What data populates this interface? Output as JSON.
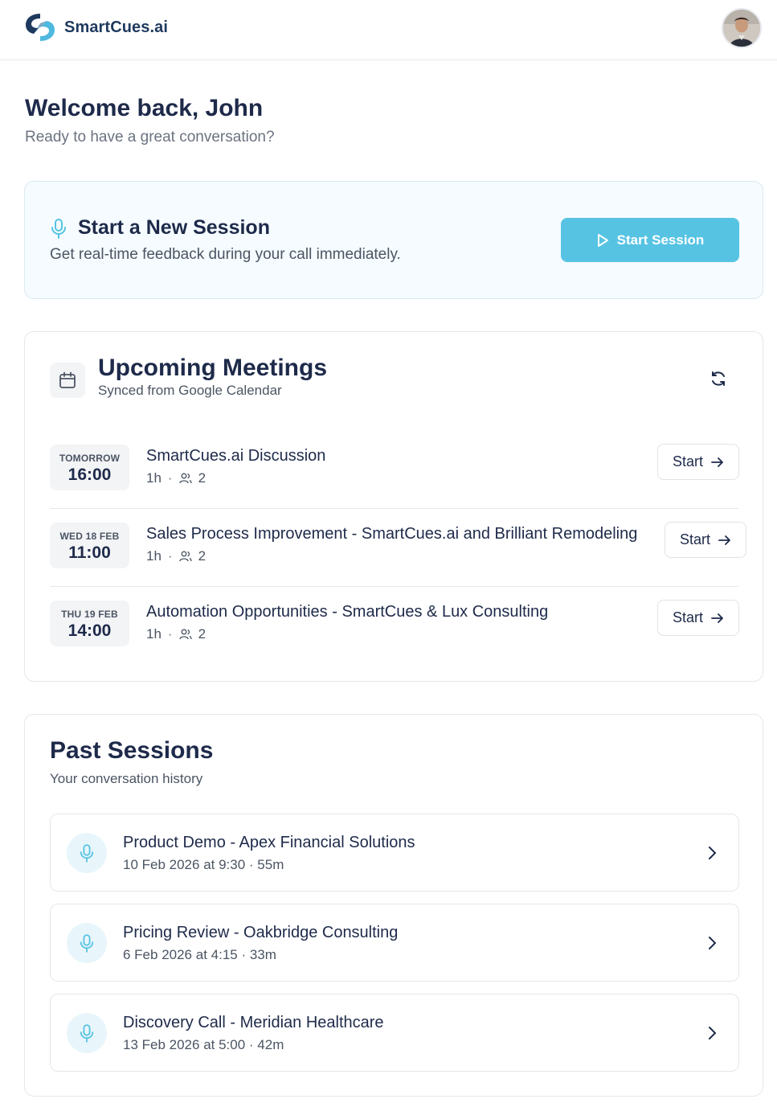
{
  "app": {
    "brand": "SmartCues.ai"
  },
  "user": {
    "avatar": "user-avatar"
  },
  "welcome": {
    "title": "Welcome back, John",
    "subtitle": "Ready to have a great conversation?"
  },
  "new_session": {
    "title": "Start a New Session",
    "subtitle": "Get real-time feedback during your call immediately.",
    "button_label": "Start Session",
    "accent_color": "#56c3e3"
  },
  "upcoming": {
    "title": "Upcoming Meetings",
    "subtitle": "Synced from Google Calendar",
    "meetings": [
      {
        "day": "TOMORROW",
        "time": "16:00",
        "title": "SmartCues.ai Discussion",
        "duration": "1h",
        "attendees": "2",
        "button": "Start"
      },
      {
        "day": "WED 18 FEB",
        "time": "11:00",
        "title": "Sales Process Improvement - SmartCues.ai and Brilliant Remodeling",
        "duration": "1h",
        "attendees": "2",
        "button": "Start"
      },
      {
        "day": "THU 19 FEB",
        "time": "14:00",
        "title": "Automation Opportunities - SmartCues & Lux Consulting",
        "duration": "1h",
        "attendees": "2",
        "button": "Start"
      }
    ]
  },
  "past": {
    "title": "Past Sessions",
    "subtitle": "Your conversation history",
    "sessions": [
      {
        "title": "Product Demo - Apex Financial Solutions",
        "meta": "10 Feb 2026 at 9:30 · 55m"
      },
      {
        "title": "Pricing Review - Oakbridge Consulting",
        "meta": "6 Feb 2026 at 4:15 · 33m"
      },
      {
        "title": "Discovery Call - Meridian Healthcare",
        "meta": "13 Feb 2026 at 5:00 · 42m"
      }
    ]
  }
}
